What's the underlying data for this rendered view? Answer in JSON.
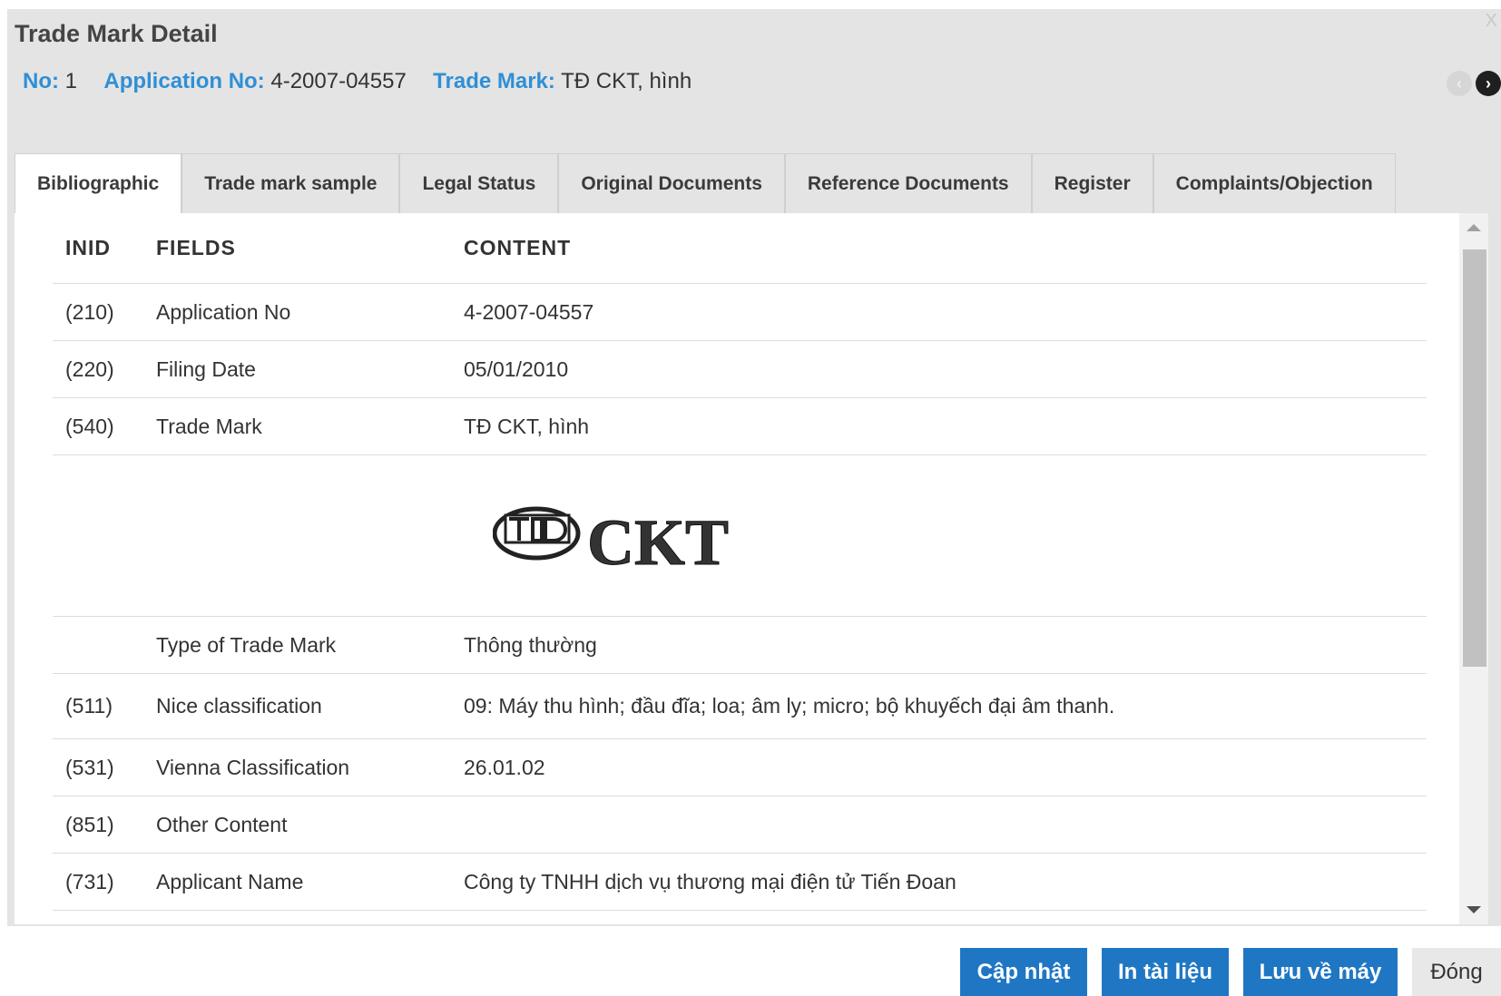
{
  "dialog": {
    "title": "Trade Mark Detail",
    "close_label": "X"
  },
  "summary": {
    "no_label": "No:",
    "no_value": "1",
    "app_label": "Application No:",
    "app_value": "4-2007-04557",
    "mark_label": "Trade Mark:",
    "mark_value": "TĐ CKT, hình"
  },
  "nav": {
    "prev_icon": "chevron-left-icon",
    "next_icon": "chevron-right-icon"
  },
  "tabs": [
    {
      "label": "Bibliographic",
      "active": true
    },
    {
      "label": "Trade mark sample"
    },
    {
      "label": "Legal Status"
    },
    {
      "label": "Original Documents"
    },
    {
      "label": "Reference Documents"
    },
    {
      "label": "Register"
    },
    {
      "label": "Complaints/Objection"
    }
  ],
  "table": {
    "headers": {
      "inid": "INID",
      "fields": "FIELDS",
      "content": "CONTENT"
    },
    "rows": [
      {
        "inid": "(210)",
        "field": "Application No",
        "content": "4-2007-04557"
      },
      {
        "inid": "(220)",
        "field": "Filing Date",
        "content": "05/01/2010"
      },
      {
        "inid": "(540)",
        "field": "Trade Mark",
        "content": "TĐ CKT, hình"
      },
      {
        "inid": "",
        "field": "Type of Trade Mark",
        "content": "Thông thường"
      },
      {
        "inid": "(511)",
        "field": "Nice classification",
        "content": "09: Máy thu hình; đầu đĩa; loa; âm ly; micro; bộ khuyếch đại âm thanh."
      },
      {
        "inid": "(531)",
        "field": "Vienna Classification",
        "content": "26.01.02"
      },
      {
        "inid": "(851)",
        "field": "Other Content",
        "content": ""
      },
      {
        "inid": "(731)",
        "field": "Applicant Name",
        "content": "Công ty TNHH dịch vụ thương mại điện tử Tiến Đoan"
      }
    ],
    "mark_logo_text": "CKT"
  },
  "footer": {
    "update_label": "Cập nhật",
    "print_label": "In tài liệu",
    "save_label": "Lưu về máy",
    "close_label": "Đóng"
  },
  "colors": {
    "accent": "#1f77c4",
    "label_blue": "#2f8fd6"
  }
}
